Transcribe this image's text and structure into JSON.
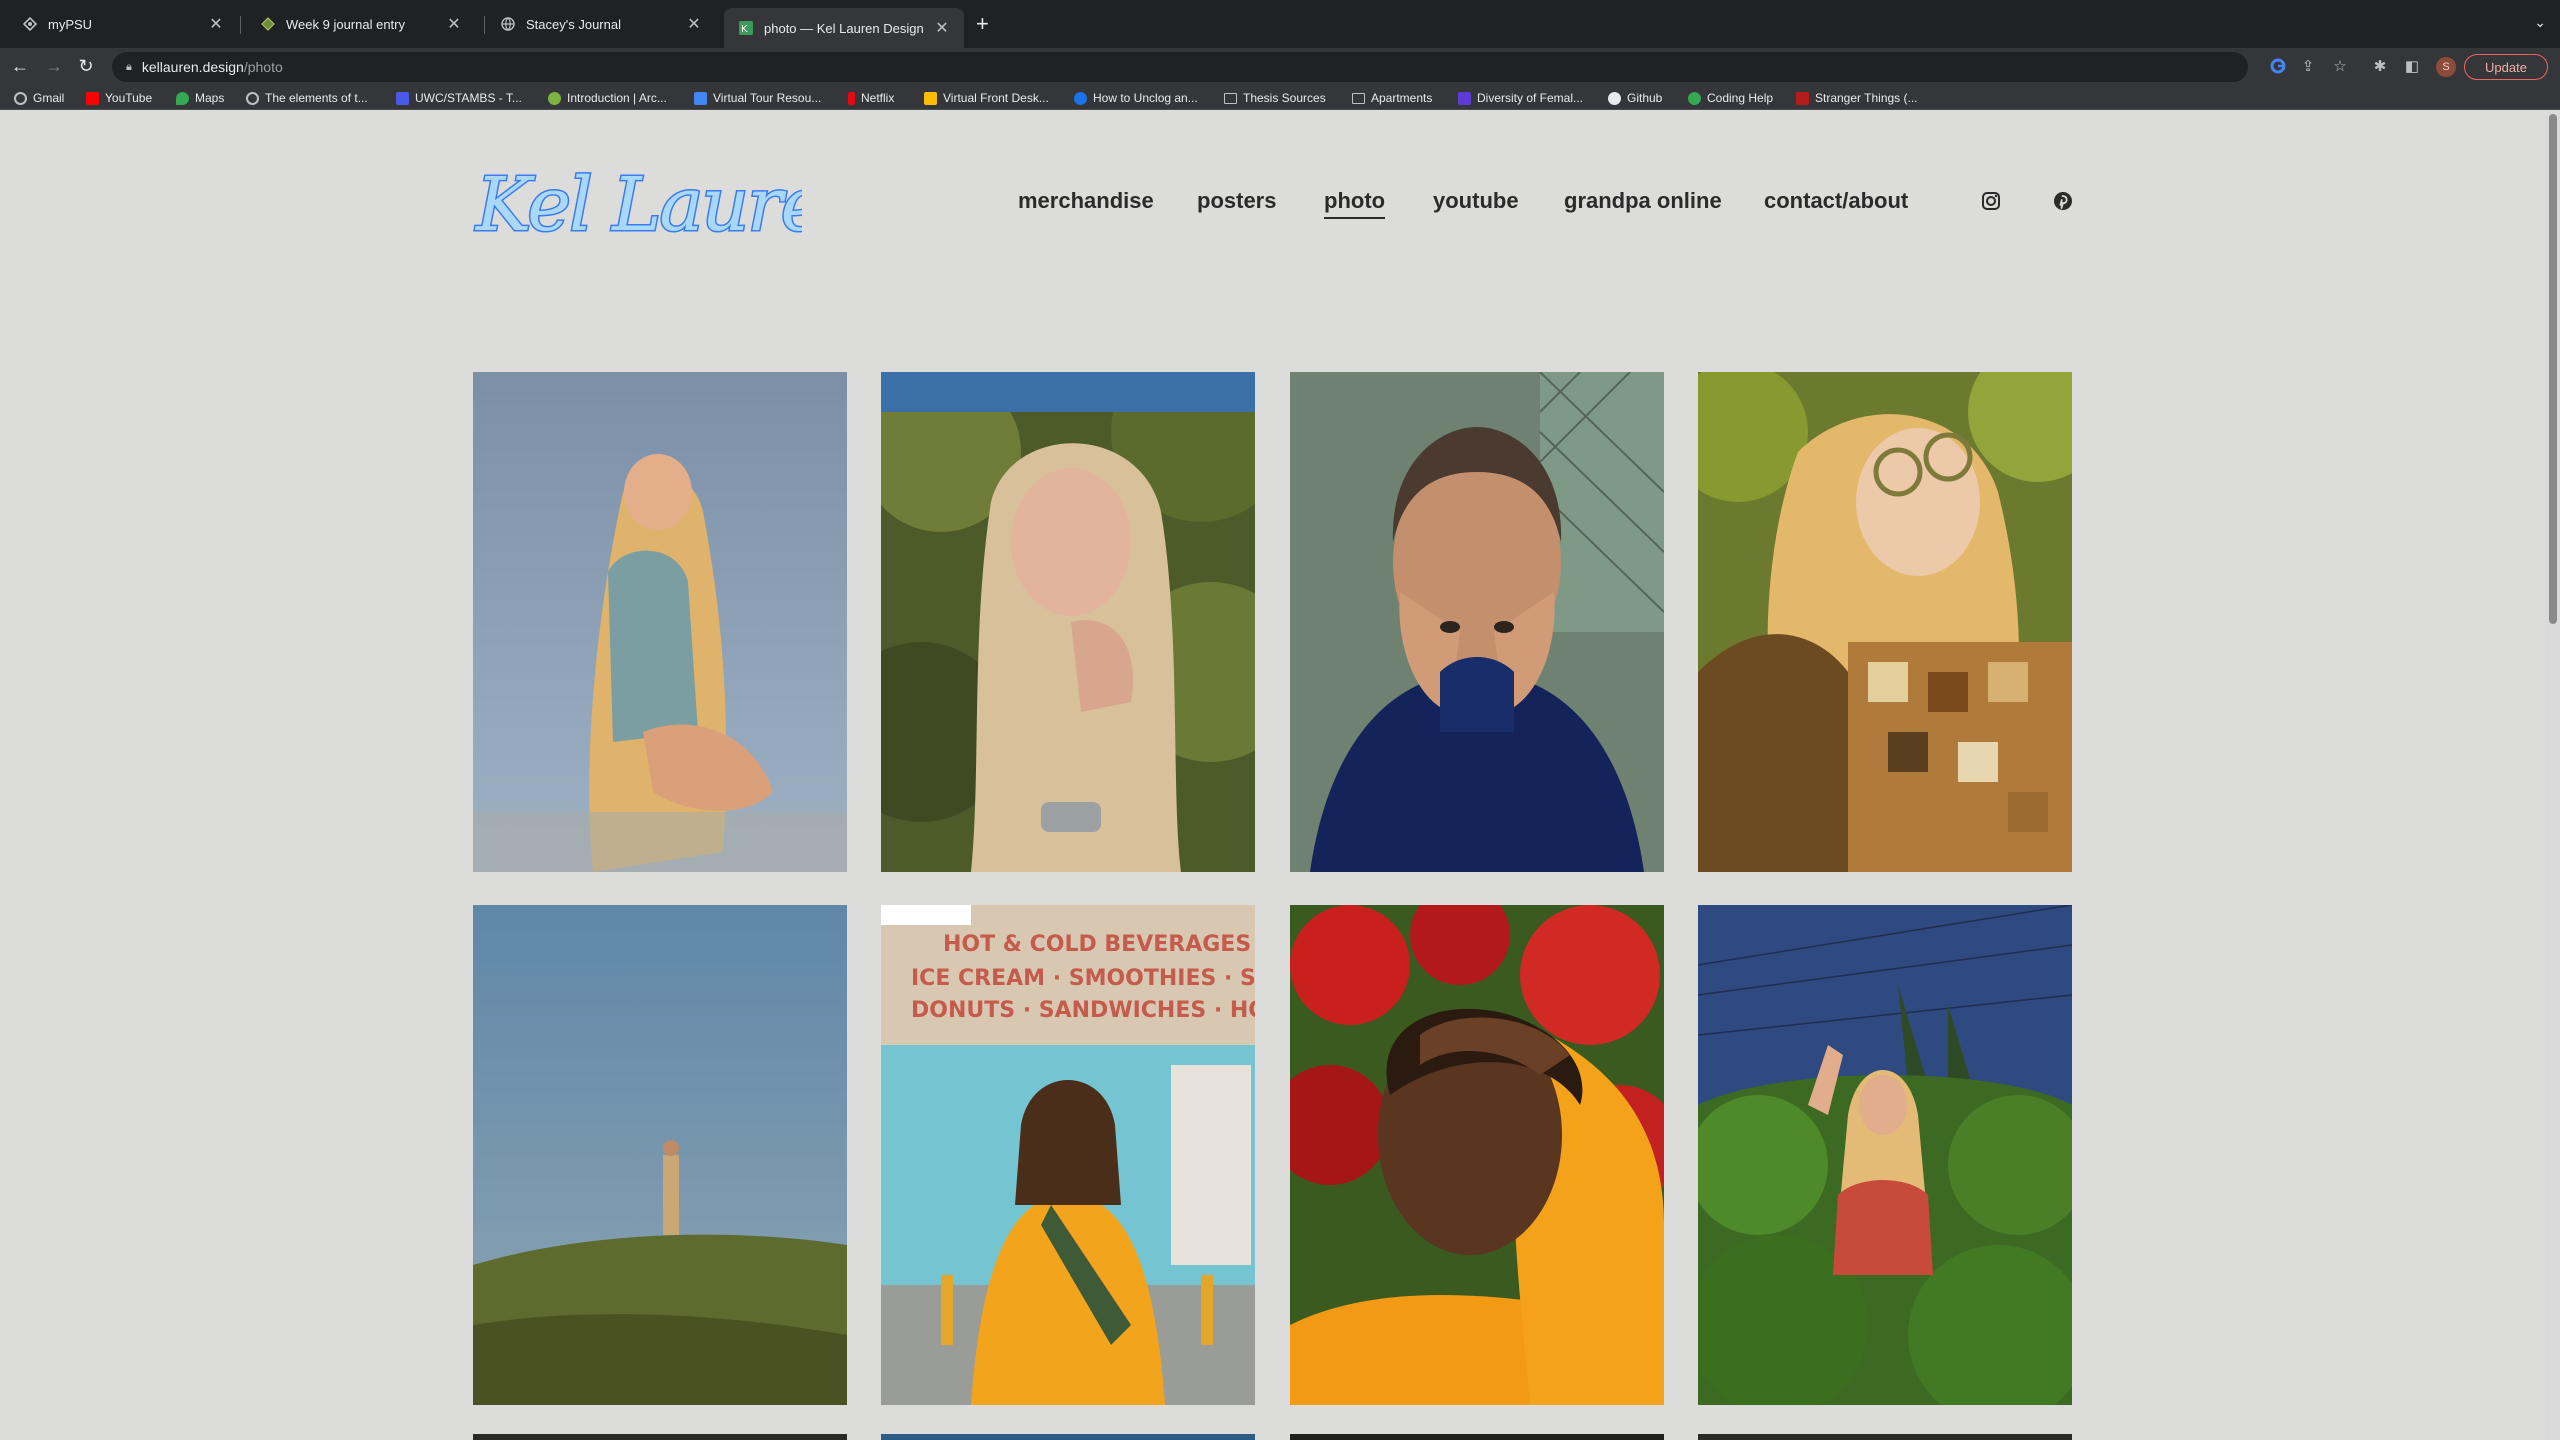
{
  "browser": {
    "tabs": [
      {
        "title": "myPSU",
        "icon": "diamond-icon"
      },
      {
        "title": "Week 9 journal entry",
        "icon": "diamond-icon"
      },
      {
        "title": "Stacey's Journal",
        "icon": "globe-icon"
      },
      {
        "title": "photo — Kel Lauren Design",
        "icon": "site-favicon",
        "active": true
      }
    ],
    "url_host": "kellauren.design",
    "url_path": "/photo",
    "profile_initial": "S",
    "update_label": "Update",
    "bookmarks": [
      {
        "label": "Gmail",
        "color": "#e8eaed"
      },
      {
        "label": "YouTube",
        "color": "#ff0000"
      },
      {
        "label": "Maps",
        "color": "#34a853"
      },
      {
        "label": "The elements of t...",
        "color": "#bdc1c6"
      },
      {
        "label": "UWC/STAMBS - T...",
        "color": "#4b5ae6"
      },
      {
        "label": "Introduction | Arc...",
        "color": "#7cb342"
      },
      {
        "label": "Virtual Tour Resou...",
        "color": "#4285f4"
      },
      {
        "label": "Netflix",
        "color": "#e50914"
      },
      {
        "label": "Virtual Front Desk...",
        "color": "#fbbc04"
      },
      {
        "label": "How to Unclog an...",
        "color": "#1a73e8"
      },
      {
        "label": "Thesis Sources",
        "color": "folder"
      },
      {
        "label": "Apartments",
        "color": "folder"
      },
      {
        "label": "Diversity of Femal...",
        "color": "#5c3bd6"
      },
      {
        "label": "Github",
        "color": "#e8eaed"
      },
      {
        "label": "Coding Help",
        "color": "#34a853"
      },
      {
        "label": "Stranger Things (...",
        "color": "#b71c1c"
      }
    ]
  },
  "site": {
    "logo_text": "Kel Lauren",
    "nav": [
      {
        "label": "merchandise"
      },
      {
        "label": "posters"
      },
      {
        "label": "photo",
        "active": true
      },
      {
        "label": "youtube"
      },
      {
        "label": "grandpa online"
      },
      {
        "label": "contact/about"
      }
    ],
    "social": [
      {
        "name": "instagram-icon"
      },
      {
        "name": "pinterest-icon"
      }
    ],
    "photos": [
      {
        "subject": "blonde woman reaching toward camera against blue sky"
      },
      {
        "subject": "blonde woman with hand on chin in greenery"
      },
      {
        "subject": "man with hands on face in navy hoodie"
      },
      {
        "subject": "laughing woman with glasses and patterned top"
      },
      {
        "subject": "figure standing on grassy hill under blue sky"
      },
      {
        "subject": "person in yellow sweatshirt before storefront"
      },
      {
        "subject": "man shading face among red flowers"
      },
      {
        "subject": "woman waving among green bushes"
      }
    ],
    "storefront_sign": [
      "HOT & COLD BEVERAGES",
      "ICE CREAM · SMOOTHIES · SAP",
      "DONUTS · SANDWICHES · HOT D"
    ]
  },
  "colors": {
    "page_bg": "#dcdcdb",
    "nav_text": "#2b2b2b",
    "logo_fill": "#a9d8f8",
    "logo_stroke": "#3a7cf0"
  }
}
